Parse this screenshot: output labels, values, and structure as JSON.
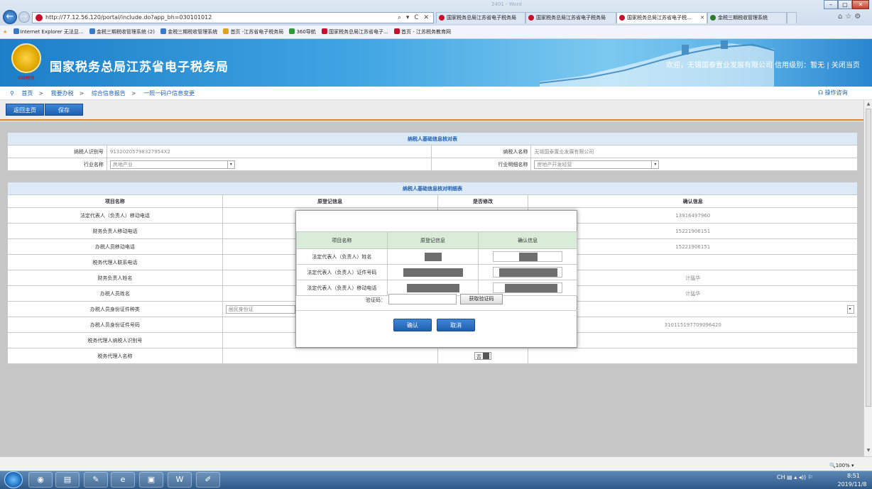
{
  "browser": {
    "url": "http://77.12.56.120/portal/include.do?app_bh=030101012",
    "faint_title": "2401 - Word",
    "address_tools": "⌕ ▾ C ✕",
    "tabs": [
      {
        "label": "国家税务总局江苏省电子税务局",
        "active": false
      },
      {
        "label": "国家税务总局江苏省电子税务局",
        "active": false
      },
      {
        "label": "国家税务总局江苏省电子税...",
        "active": true
      },
      {
        "label": "金税三期税收管理系统",
        "active": false
      }
    ],
    "favorites": [
      "Internet Explorer 无法显...",
      "金税三期税收管理系统 (2)",
      "金税三期税收管理系统",
      "首页 -江苏省电子税务局",
      "360导航",
      "国家税务总局江苏省电子...",
      "首页 - 江苏税务教育网"
    ]
  },
  "site": {
    "title": "国家税务总局江苏省电子税务局",
    "emblem_caption": "中国税务",
    "welcome": "欢迎，无锡国泰置业发展有限公司  信用级别：暂无 | 关闭当页"
  },
  "breadcrumb": {
    "items": [
      "首页",
      "我要办税",
      "综合信息报告",
      "一照一码户信息变更"
    ],
    "help": "操作咨询"
  },
  "toolbar": {
    "back": "返回主页",
    "save": "保存"
  },
  "basic": {
    "title": "纳税人基础信息核对表",
    "rows": [
      {
        "l1": "纳税人识别号",
        "v1": "91320205798327954X2",
        "l2": "纳税人名称",
        "v2": "无锡国泰置业发展有限公司"
      },
      {
        "l1": "行业名称",
        "v1": "房地产业",
        "l2": "行业明细名称",
        "v2": "房地产开发经营"
      }
    ]
  },
  "detail": {
    "title": "纳税人基础信息核对明细表",
    "headers": [
      "项目名称",
      "原登记信息",
      "是否修改",
      "确认信息"
    ],
    "rows": [
      {
        "name": "法定代表人（负责人）移动电话",
        "orig": "",
        "mod": "",
        "confirm": "13916497960"
      },
      {
        "name": "财务负责人移动电话",
        "orig": "",
        "mod": "",
        "confirm": "15221906151"
      },
      {
        "name": "办税人员移动电话",
        "orig": "",
        "mod": "",
        "confirm": "15221906151"
      },
      {
        "name": "税务代理人联系电话",
        "orig": "",
        "mod": "",
        "confirm": ""
      },
      {
        "name": "财务负责人姓名",
        "orig": "",
        "mod": "",
        "confirm": "计猛华"
      },
      {
        "name": "办税人员姓名",
        "orig": "",
        "mod": "",
        "confirm": "计猛华"
      },
      {
        "name": "办税人员身份证件种类",
        "orig": "居民身份证",
        "mod": "",
        "confirm": ""
      },
      {
        "name": "办税人员身份证件号码",
        "orig": "",
        "mod": "",
        "confirm": "310115197709096420"
      },
      {
        "name": "税务代理人纳税人识别号",
        "orig": "",
        "mod": "",
        "confirm": ""
      },
      {
        "name": "税务代理人名称",
        "orig": "",
        "mod": "否",
        "confirm": ""
      }
    ]
  },
  "modal": {
    "headers": [
      "项目名称",
      "原登记信息",
      "确认信息"
    ],
    "rows": [
      {
        "name": "法定代表人（负责人）姓名"
      },
      {
        "name": "法定代表人（负责人）证件号码"
      },
      {
        "name": "法定代表人（负责人）移动电话"
      }
    ],
    "captcha_label": "验证码：",
    "captcha_button": "获取验证码",
    "confirm": "确认",
    "cancel": "取消"
  },
  "status": {
    "zoom": "🔍100%  ▾"
  },
  "taskbar": {
    "tray": "CH ▤ ▴ ◂)) ⚐",
    "time": "8:51",
    "date": "2019/11/8"
  },
  "colors": {
    "accent": "#1f5fb0",
    "divider": "#e07f2b",
    "modal_header": "#d8ecd8"
  }
}
